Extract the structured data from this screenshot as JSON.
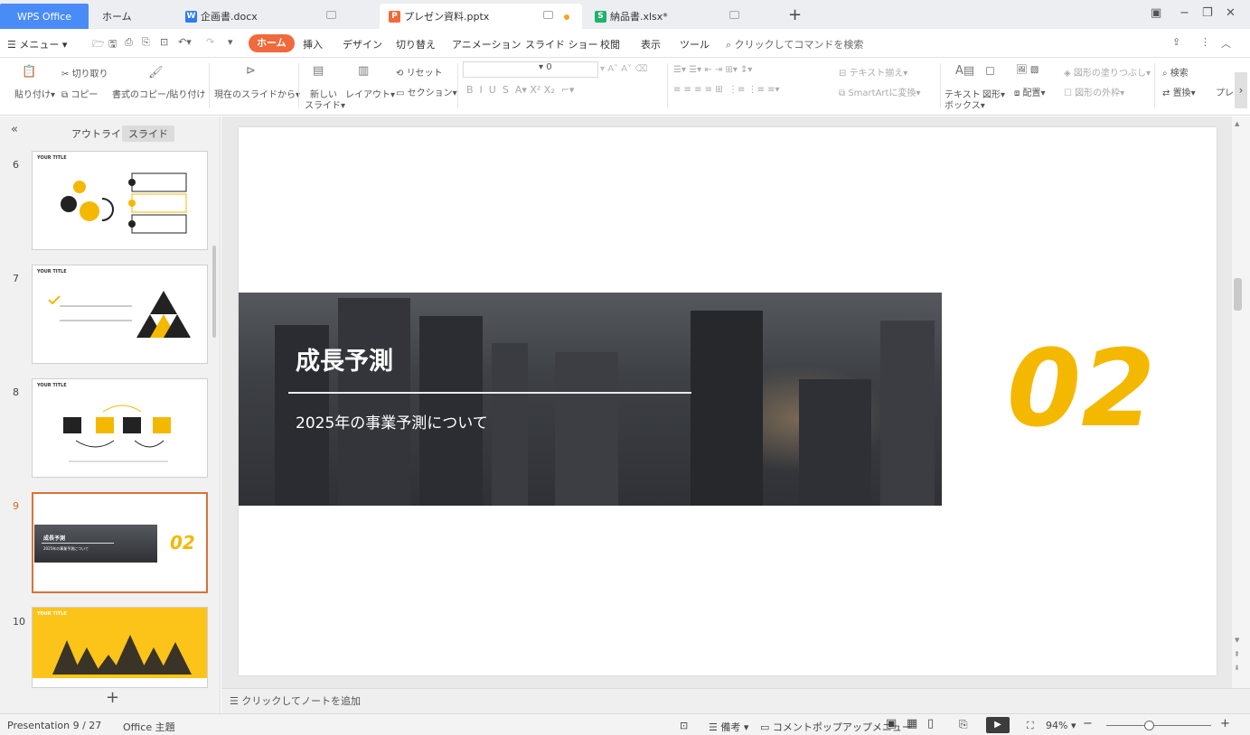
{
  "tabs": {
    "wps": "WPS Office",
    "home": "ホーム",
    "doc": "企画書.docx",
    "ppt": "プレゼン資料.pptx",
    "xls": "納品書.xlsx*"
  },
  "menubar": {
    "menu": "メニュー",
    "home": "ホーム",
    "items": [
      "挿入",
      "デザイン",
      "切り替え",
      "アニメーション",
      "スライド ショー",
      "校閲",
      "表示",
      "ツール"
    ],
    "command_search": "クリックしてコマンドを検索"
  },
  "ribbon": {
    "paste": "貼り付け",
    "cut": "切り取り",
    "copy": "コピー",
    "format_copy": "書式のコピー/貼り付け",
    "from_current": "現在のスライドから",
    "new_slide_1": "新しい",
    "new_slide_2": "スライド",
    "layout": "レイアウト",
    "reset": "リセット",
    "section": "セクション",
    "font_size": "0",
    "text_align": "テキスト揃え",
    "smartart": "SmartArtに変換",
    "textbox_1": "テキスト",
    "textbox_2": "ボックス",
    "shape": "図形",
    "arrange": "配置",
    "shape_fill": "図形の塗りつぶし",
    "shape_outline": "図形の外枠",
    "find": "検索",
    "replace": "置換",
    "more": "プレ"
  },
  "panel": {
    "outline_tab": "アウトライン",
    "slides_tab": "スライド",
    "thumbnails": [
      {
        "number": "6",
        "title": "YOUR TITLE"
      },
      {
        "number": "7",
        "title": "YOUR TITLE"
      },
      {
        "number": "8",
        "title": "YOUR TITLE"
      },
      {
        "number": "9",
        "title": "成長予測",
        "subtitle": "2025年の事業予測について",
        "num": "02"
      },
      {
        "number": "10",
        "title": "YOUR TITLE"
      }
    ]
  },
  "slide": {
    "title": "成長予測",
    "subtitle": "2025年の事業予測について",
    "section_number": "02",
    "accent_color": "#f5b800"
  },
  "notes": {
    "placeholder": "クリックしてノートを追加"
  },
  "status": {
    "presentation": "Presentation 9 / 27",
    "theme": "Office 主題",
    "notes_btn": "備考",
    "comment_menu": "コメントポップアップメニュー",
    "zoom": "94%"
  },
  "colors": {
    "brand": "#4a8cf7",
    "home_button": "#f06a3b",
    "selected_thumb": "#d7733a"
  }
}
